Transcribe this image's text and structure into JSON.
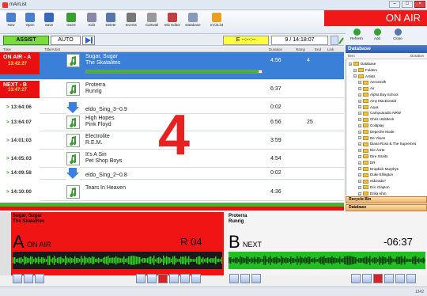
{
  "window": {
    "title": "mAirList"
  },
  "toolbar": {
    "buttons": [
      {
        "label": "New",
        "icon": "new-file-icon",
        "color": "#4a7fcc"
      },
      {
        "label": "Open",
        "icon": "open-folder-icon",
        "color": "#4a7fcc"
      },
      {
        "label": "Save",
        "icon": "save-icon",
        "color": "#3a68b8"
      },
      {
        "label": "Insert",
        "icon": "insert-icon",
        "color": "#38a030"
      },
      {
        "label": "Edit",
        "icon": "edit-icon",
        "color": "#8888aa"
      },
      {
        "label": "Delete",
        "icon": "delete-icon",
        "color": "#5577aa"
      },
      {
        "label": "Events",
        "icon": "events-icon",
        "color": "#777"
      },
      {
        "label": "Cartwall",
        "icon": "cartwall-icon",
        "color": "#999"
      },
      {
        "label": "Mix Editor",
        "icon": "mix-editor-icon",
        "color": "#c04040"
      },
      {
        "label": "Database",
        "icon": "database-icon",
        "color": "#8899bb"
      },
      {
        "label": "mAirList",
        "icon": "mairlist-icon",
        "color": "#e8a020"
      }
    ],
    "db_buttons": [
      {
        "label": "Refresh",
        "icon": "refresh-icon"
      },
      {
        "label": "Add",
        "icon": "add-icon"
      },
      {
        "label": "Close",
        "icon": "close-icon"
      }
    ]
  },
  "status": {
    "on_air": "ON AIR",
    "assist": "ASSIST",
    "auto": "AUTO",
    "countdown": "E  --:--:--",
    "clock": "9 / 14:18:07"
  },
  "list": {
    "headers": [
      "Time",
      "Title/Artist",
      "Duration",
      "Ramp",
      "End",
      "Link"
    ],
    "rows": [
      {
        "time": "",
        "title": "Sugar, Sugar",
        "artist": "The Skatalites",
        "duration": "4:56",
        "ramp": "4",
        "kind": "song",
        "state": "onair"
      },
      {
        "time": "",
        "title": "Proterra",
        "artist": "Runrig",
        "duration": "6:37",
        "ramp": "",
        "kind": "song",
        "state": "next"
      },
      {
        "time": "13:64:06",
        "title": "eldo_Sing_3~0.9",
        "artist": "",
        "duration": "0:02",
        "ramp": "",
        "kind": "jingle"
      },
      {
        "time": "13:64:07",
        "title": "High Hopes",
        "artist": "Pink Floyd",
        "duration": "6:56",
        "ramp": "25",
        "kind": "song"
      },
      {
        "time": "14:01:03",
        "title": "Electrolite",
        "artist": "R.E.M.",
        "duration": "3:59",
        "ramp": "",
        "kind": "song"
      },
      {
        "time": "14:05:03",
        "title": "It's A Sin",
        "artist": "Pet Shop Boys",
        "duration": "4:54",
        "ramp": "",
        "kind": "song"
      },
      {
        "time": "14:09:58",
        "title": "eldo_Sing_2~0.8",
        "artist": "",
        "duration": "0:02",
        "ramp": "",
        "kind": "jingle"
      },
      {
        "time": "14:10:00",
        "title": "Tears In Heaven",
        "artist": "",
        "duration": "4:36",
        "ramp": "",
        "kind": "song"
      }
    ],
    "onair_label": "ON AIR - A",
    "onair_time": "13:42:27",
    "next_label": "NEXT - B",
    "next_time": "13:47:27",
    "overlay_number": "4"
  },
  "database": {
    "title": "Database",
    "col_item": "Item",
    "col_duration": "Duration",
    "tree": [
      {
        "label": "Database",
        "depth": 0
      },
      {
        "label": "Folders",
        "depth": 1
      },
      {
        "label": "Artists",
        "depth": 1
      },
      {
        "label": "Aerosmith",
        "depth": 2
      },
      {
        "label": "Air",
        "depth": 2
      },
      {
        "label": "Alpha Boy School",
        "depth": 2
      },
      {
        "label": "Amy MacDonald",
        "depth": 2
      },
      {
        "label": "Aqua",
        "depth": 2
      },
      {
        "label": "Campuaradio NRW",
        "depth": 2
      },
      {
        "label": "Chris Hülsbeck",
        "depth": 2
      },
      {
        "label": "Coldplay",
        "depth": 2
      },
      {
        "label": "Depeche Mode",
        "depth": 2
      },
      {
        "label": "De Vision",
        "depth": 2
      },
      {
        "label": "Diana Ross & The Supremes",
        "depth": 2
      },
      {
        "label": "Die Ärzte",
        "depth": 2
      },
      {
        "label": "Dire Straits",
        "depth": 2
      },
      {
        "label": "DR",
        "depth": 2
      },
      {
        "label": "Dropkick Murphys",
        "depth": 2
      },
      {
        "label": "Duke Ellington",
        "depth": 2
      },
      {
        "label": "eldoradio*",
        "depth": 2
      },
      {
        "label": "Eric Clapton",
        "depth": 2
      },
      {
        "label": "Erika Ahm",
        "depth": 2
      }
    ],
    "recycle_bin": "Recycle Bin",
    "database_tab": "Database"
  },
  "playerA": {
    "title": "Sugar, Sugar",
    "artist": "The Skatalites",
    "letter": "A",
    "state": "ON AIR",
    "remaining": "R 04"
  },
  "playerB": {
    "title": "Proterra",
    "artist": "Runrig",
    "letter": "B",
    "state": "NEXT",
    "remaining": "-06:37"
  },
  "statusbar": {
    "text": "1342"
  }
}
